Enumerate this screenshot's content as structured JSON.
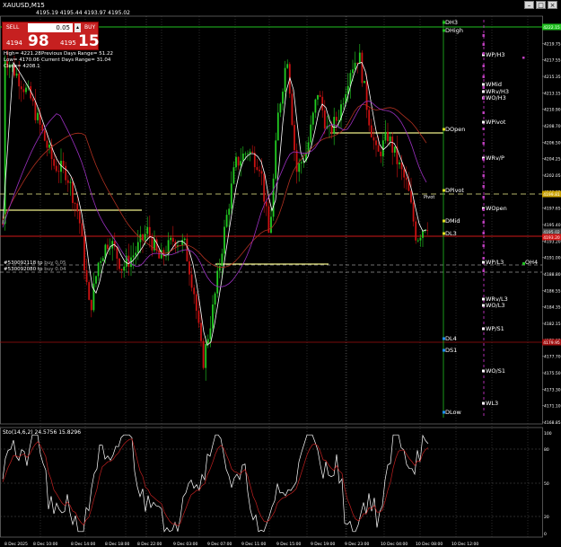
{
  "window": {
    "title": "XAUUSD,M15",
    "buttons": [
      "–",
      "□",
      "×"
    ]
  },
  "trade_panel": {
    "sell_label": "SELL",
    "buy_label": "BUY",
    "lot_value": "0.05",
    "sell_price_small": "4194",
    "sell_price_big": "98",
    "buy_price_small": "4195",
    "buy_price_big": "15"
  },
  "header_quote": "4195.19 4195.44 4193.97 4195.02",
  "info": {
    "high": "High= 4221.28",
    "low": "Low= 4170.06",
    "close": "Close= 4208.1",
    "prev_days_range": "Previous Days Range= 51.22",
    "curr_days_range": "Current Days Range= 31.04"
  },
  "indicator_label": "Sto(14,6,2) 24.5756 15.8296",
  "order_labels": {
    "order1": "#530092118 tp",
    "order1_suffix": "buy 0.05",
    "order2": "#530092080 tp",
    "order2_suffix": "buy 0.04"
  },
  "pivot_text": "Pivot",
  "price_axis": [
    "4222.15",
    "4219.75",
    "4217.55",
    "4215.35",
    "4213.15",
    "4210.90",
    "4208.70",
    "4206.50",
    "4204.25",
    "4202.05",
    "4199.85",
    "4197.65",
    "4195.40",
    "4193.20",
    "4191.00",
    "4188.80",
    "4186.55",
    "4184.35",
    "4182.15",
    "4179.95",
    "4177.70",
    "4175.50",
    "4173.30",
    "4171.10",
    "4168.85"
  ],
  "price_markers": {
    "top_green": "4222.15",
    "yellow_dash": "4199.81",
    "red_line": "4195.02",
    "red_line2": "4193.20",
    "red_low": "4179.95"
  },
  "osc_axis": [
    "100",
    "80",
    "50",
    "20",
    "0"
  ],
  "time_axis": [
    "8 Dec 2025",
    "8 Dec 10:00",
    "8 Dec 14:00",
    "8 Dec 18:00",
    "8 Dec 22:00",
    "9 Dec 03:00",
    "9 Dec 07:00",
    "9 Dec 11:00",
    "9 Dec 15:00",
    "9 Dec 19:00",
    "9 Dec 23:00",
    "10 Dec 04:00",
    "10 Dec 08:00",
    "10 Dec 12:00"
  ],
  "levels": {
    "daily": [
      "DH3",
      "DHigh",
      "DOpen",
      "DPivot",
      "DMid",
      "DL3",
      "DL4",
      "DS1",
      "DLow"
    ],
    "weekly": [
      "WP/H3",
      "WMid",
      "WRv/H3",
      "WO/H3",
      "WPivot",
      "WRv/P",
      "WOpen",
      "WP/L3",
      "WRv/L3",
      "WO/L3",
      "WP/S1",
      "WO/S1",
      "WL3"
    ],
    "other": [
      "OH4"
    ]
  },
  "colors": {
    "background": "#000000",
    "bull": "#22cc22",
    "bear": "#cc1111",
    "level_yellow": "#f0f08a",
    "sell_panel": "#c62020",
    "ma_white": "#ffffff",
    "ma_red": "#b03020",
    "ma_purple": "#9b30c0"
  }
}
